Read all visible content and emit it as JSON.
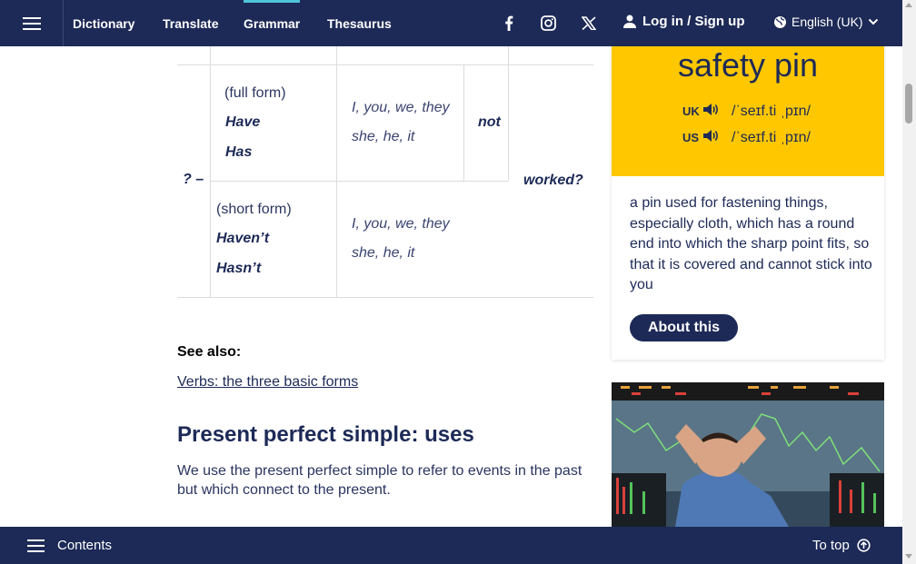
{
  "nav": {
    "links": [
      "Dictionary",
      "Translate",
      "Grammar",
      "Thesaurus"
    ],
    "active": "Grammar",
    "social": [
      "facebook-icon",
      "instagram-icon",
      "x-icon"
    ],
    "login": "Log in / Sign up",
    "language": "English (UK)"
  },
  "table": {
    "mark": "? –",
    "full_form_label": "(full form)",
    "full_have": "Have",
    "full_has": "Has",
    "subjects_1": "I, you, we, they",
    "subjects_2": "she, he, it",
    "not": "not",
    "verb": "worked?",
    "short_form_label": "(short form)",
    "short_havent": "Haven’t",
    "short_hasnt": "Hasn’t"
  },
  "content": {
    "see_also": "See also:",
    "verbs_link": "Verbs: the three basic forms",
    "section_title": "Present perfect simple: uses",
    "body": "We use the present perfect simple to refer to events in the past but which connect to the present."
  },
  "word_card": {
    "word": "safety pin",
    "uk_label": "UK",
    "uk_ipa": "/ˈseɪf.ti ˌpɪn/",
    "us_label": "US",
    "us_ipa": "/ˈseɪf.ti ˌpɪn/",
    "definition": "a pin used for fastening things, especially cloth, which has a round end into which the sharp point fits, so that it is covered and cannot stick into you",
    "about_button": "About this"
  },
  "bottom": {
    "contents": "Contents",
    "to_top": "To top"
  },
  "colors": {
    "navy": "#1d2a57",
    "accent": "#fec700",
    "active_tab": "#4fc3d9"
  }
}
